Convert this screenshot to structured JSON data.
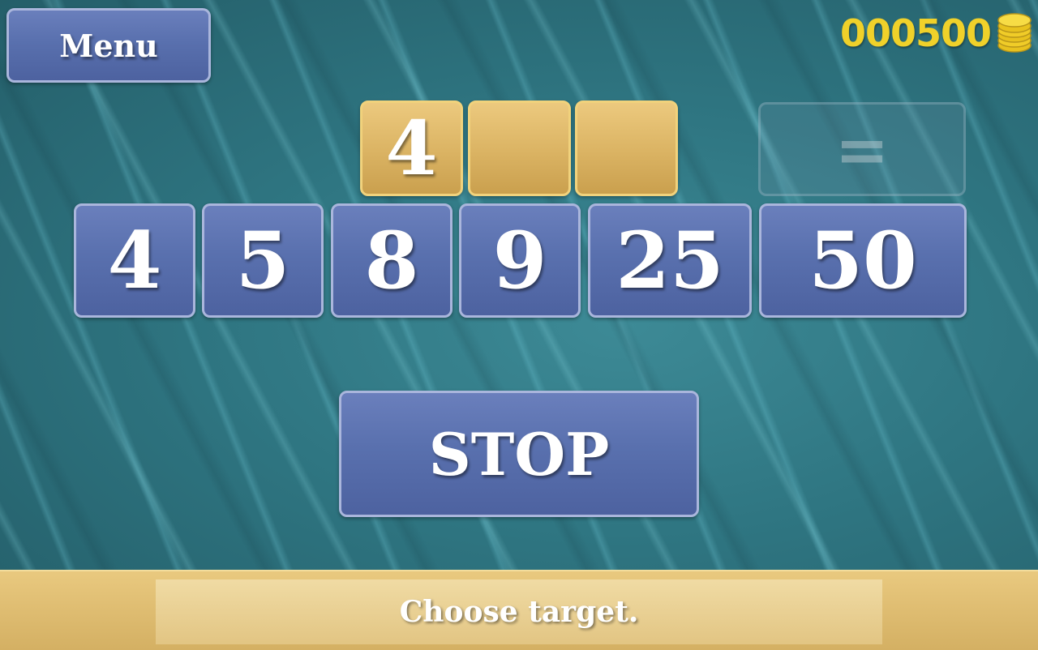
{
  "menu": {
    "label": "Menu"
  },
  "score": {
    "value": "000500",
    "icon": "coins-icon",
    "color": "#f0d12a"
  },
  "expression": {
    "slots": [
      "4",
      "",
      ""
    ],
    "equals": "="
  },
  "numbers": [
    "4",
    "5",
    "8",
    "9",
    "25",
    "50"
  ],
  "stop": {
    "label": "STOP"
  },
  "status": {
    "text": "Choose target."
  }
}
